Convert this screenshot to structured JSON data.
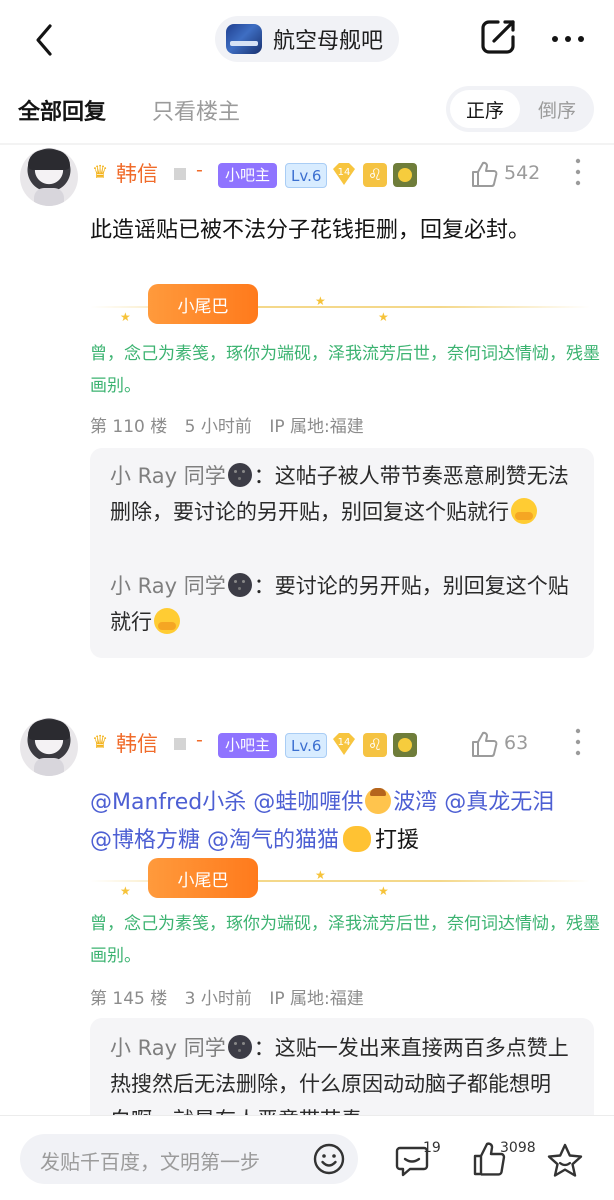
{
  "header": {
    "forum_name": "航空母舰吧",
    "icons": [
      "back-icon",
      "share-icon",
      "more-icon"
    ]
  },
  "tabs": {
    "all_replies": "全部回复",
    "op_only": "只看楼主",
    "order_asc": "正序",
    "order_desc": "倒序"
  },
  "posts": [
    {
      "username": "韩信",
      "separator": "-",
      "mod_badge": "小吧主",
      "level": "Lv.6",
      "gem_level": "14",
      "likes": "542",
      "content": "此造谣贴已被不法分子花钱拒删，回复必封。",
      "tail_label": "小尾巴",
      "poem": "曾，念己为素笺，琢你为端砚，泽我流芳后世，奈何词达情恸，残墨画别。",
      "floor": "第 110 楼",
      "time": "5 小时前",
      "ip": "IP 属地:福建",
      "replies": [
        {
          "name": "小 Ray 同学",
          "colon": "：",
          "text": "这帖子被人带节奏恶意刷赞无法删除，要讨论的另开贴，别回复这个贴就行"
        },
        {
          "name": "小 Ray 同学",
          "colon": "：",
          "text": "要讨论的另开贴，别回复这个贴就行"
        }
      ]
    },
    {
      "username": "韩信",
      "separator": "-",
      "mod_badge": "小吧主",
      "level": "Lv.6",
      "gem_level": "14",
      "likes": "63",
      "mentions": {
        "m1": "@Manfred小杀",
        "m2": "@蛙咖喱供",
        "m2_tail": "波湾",
        "m3": "@真龙无泪",
        "m4": "@博格方糖",
        "m5": "@淘气的猫猫",
        "after": "打援"
      },
      "tail_label": "小尾巴",
      "poem": "曾，念己为素笺，琢你为端砚，泽我流芳后世，奈何词达情恸，残墨画别。",
      "floor": "第 145 楼",
      "time": "3 小时前",
      "ip": "IP 属地:福建",
      "replies": [
        {
          "name": "小 Ray 同学",
          "colon": "：",
          "text": "这贴一发出来直接两百多点赞上热搜然后无法删除，什么原因动动脑子都能想明白啊，就是有人恶意带节奏，一"
        }
      ]
    }
  ],
  "bottom": {
    "input_placeholder": "发贴千百度，文明第一步",
    "comment_count": "19",
    "like_count": "3098"
  },
  "colors": {
    "username": "#f06b2a",
    "mod_badge": "#8f74ff",
    "poem": "#3cb371",
    "mention": "#4d5fd3"
  }
}
